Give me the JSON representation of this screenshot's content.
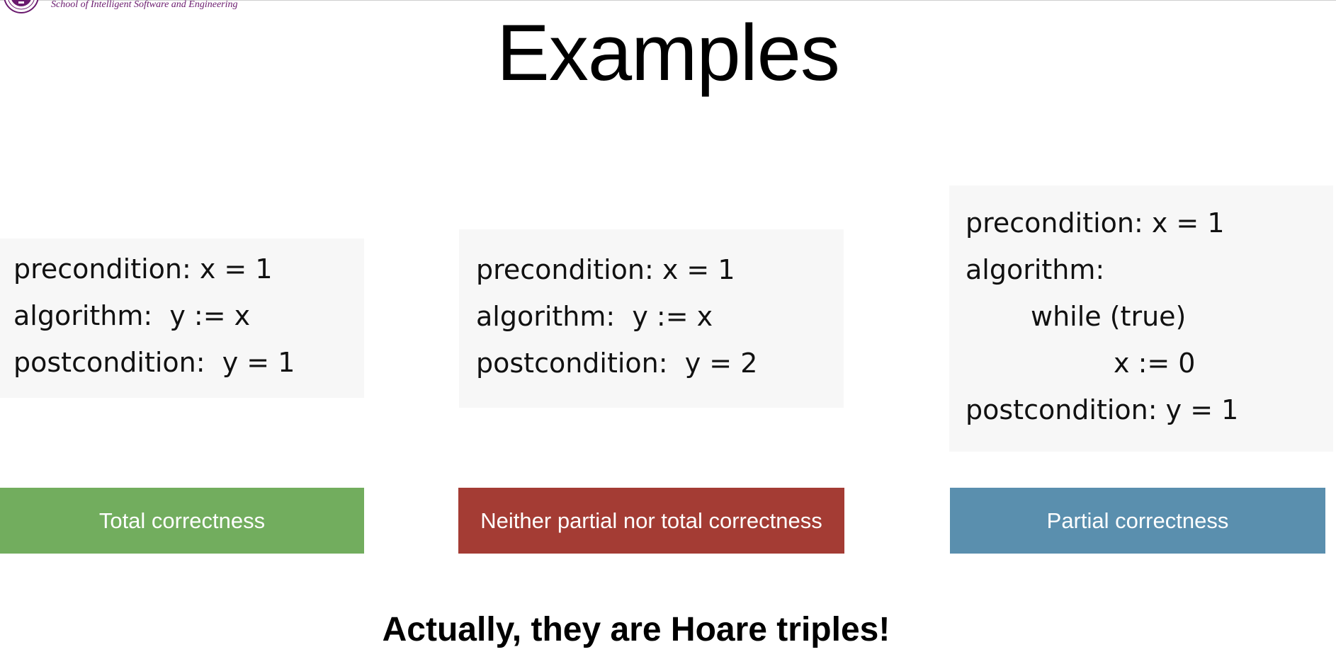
{
  "header": {
    "school_name": "School of Intelligent Software and Engineering",
    "logo_icon": "university-seal-icon",
    "logo_color": "#6a1a6e"
  },
  "slide": {
    "title": "Examples",
    "footer": "Actually, they are Hoare triples!"
  },
  "examples": [
    {
      "lines": [
        "precondition: x = 1",
        "algorithm:  y := x",
        "postcondition:  y = 1"
      ],
      "verdict": "Total correctness",
      "verdict_color": "#72ad5e"
    },
    {
      "lines": [
        "precondition: x = 1",
        "algorithm:  y := x",
        "postcondition:  y = 2"
      ],
      "verdict": "Neither partial nor total correctness",
      "verdict_color": "#a43c34"
    },
    {
      "lines": [
        "precondition: x = 1",
        "algorithm:",
        "while (true)",
        "x := 0",
        "postcondition: y = 1"
      ],
      "verdict": "Partial correctness",
      "verdict_color": "#5a8fae"
    }
  ]
}
